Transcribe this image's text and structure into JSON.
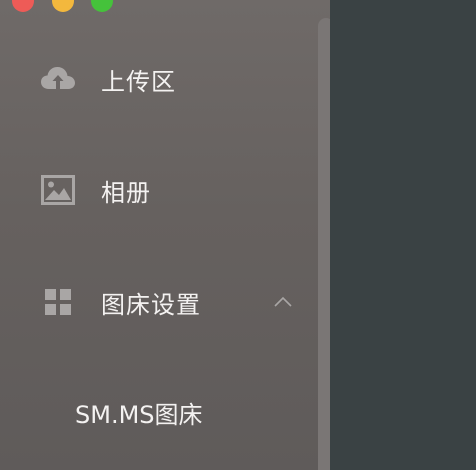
{
  "window": {
    "controls": [
      "close",
      "minimize",
      "zoom"
    ]
  },
  "sidebar": {
    "items": [
      {
        "label": "上传区",
        "icon": "cloud-upload-icon"
      },
      {
        "label": "相册",
        "icon": "image-icon"
      },
      {
        "label": "图床设置",
        "icon": "grid-icon",
        "expanded": true,
        "children": [
          {
            "label": "SM.MS图床"
          }
        ]
      }
    ]
  },
  "colors": {
    "sidebar_bg": "#6a6564",
    "content_bg": "#3a4244",
    "text": "#f4f2f1",
    "icon": "#a9a6a5",
    "close": "#ee5b57",
    "minimize": "#f3b83d",
    "zoom": "#45c23b"
  }
}
